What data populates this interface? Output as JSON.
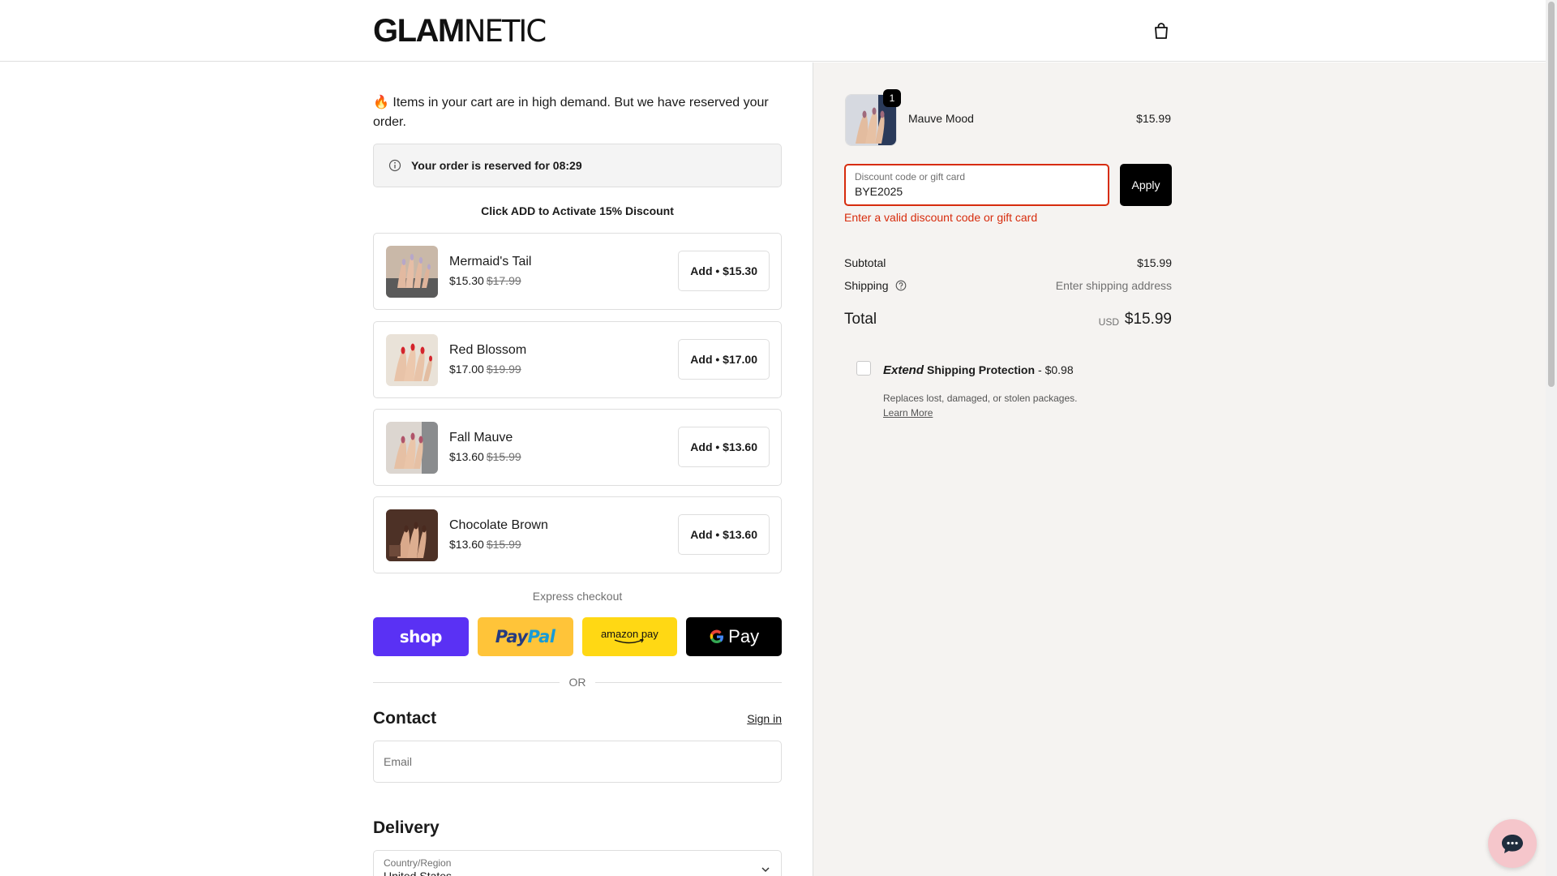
{
  "header": {
    "logo_bold": "GLAM",
    "logo_thin": "NETIC",
    "cart_icon": "shopping-bag-icon"
  },
  "main": {
    "demand_emoji": "🔥",
    "demand_text": "Items in your cart are in high demand. But we have reserved your order.",
    "reserve_text": "Your order is reserved for 08:29",
    "activate_text": "Click ADD to Activate 15% Discount",
    "upsells": [
      {
        "name": "Mermaid's Tail",
        "price": "$15.30",
        "was": "$17.99",
        "button": "Add • $15.30"
      },
      {
        "name": "Red Blossom",
        "price": "$17.00",
        "was": "$19.99",
        "button": "Add • $17.00"
      },
      {
        "name": "Fall Mauve",
        "price": "$13.60",
        "was": "$15.99",
        "button": "Add • $13.60"
      },
      {
        "name": "Chocolate Brown",
        "price": "$13.60",
        "was": "$15.99",
        "button": "Add • $13.60"
      }
    ],
    "express_label": "Express checkout",
    "pay": {
      "shop": "shop",
      "paypal_1": "Pay",
      "paypal_2": "Pal",
      "amazon": "amazon pay",
      "gpay": "Pay"
    },
    "or_text": "OR",
    "contact_title": "Contact",
    "sign_in": "Sign in",
    "email_placeholder": "Email",
    "delivery_title": "Delivery",
    "country_label": "Country/Region",
    "country_value": "United States"
  },
  "summary": {
    "product_name": "Mauve Mood",
    "product_price": "$15.99",
    "quantity": "1",
    "discount_label": "Discount code or gift card",
    "discount_value": "BYE2025",
    "apply": "Apply",
    "discount_error": "Enter a valid discount code or gift card",
    "subtotal_label": "Subtotal",
    "subtotal_value": "$15.99",
    "shipping_label": "Shipping",
    "shipping_value": "Enter shipping address",
    "total_label": "Total",
    "total_currency": "USD",
    "total_value": "$15.99",
    "extend_brand": "Extend",
    "extend_title": "Shipping Protection",
    "extend_cost": "- $0.98",
    "extend_desc": "Replaces lost, damaged, or stolen packages.",
    "extend_learn": "Learn More"
  },
  "colors": {
    "shop_pay": "#5a31f4",
    "paypal": "#ffc439",
    "amazon_pay": "#ffd814",
    "error": "#d72c0d",
    "summary_bg": "#f5f3f1",
    "chat_bubble": "#f5c6cb"
  }
}
